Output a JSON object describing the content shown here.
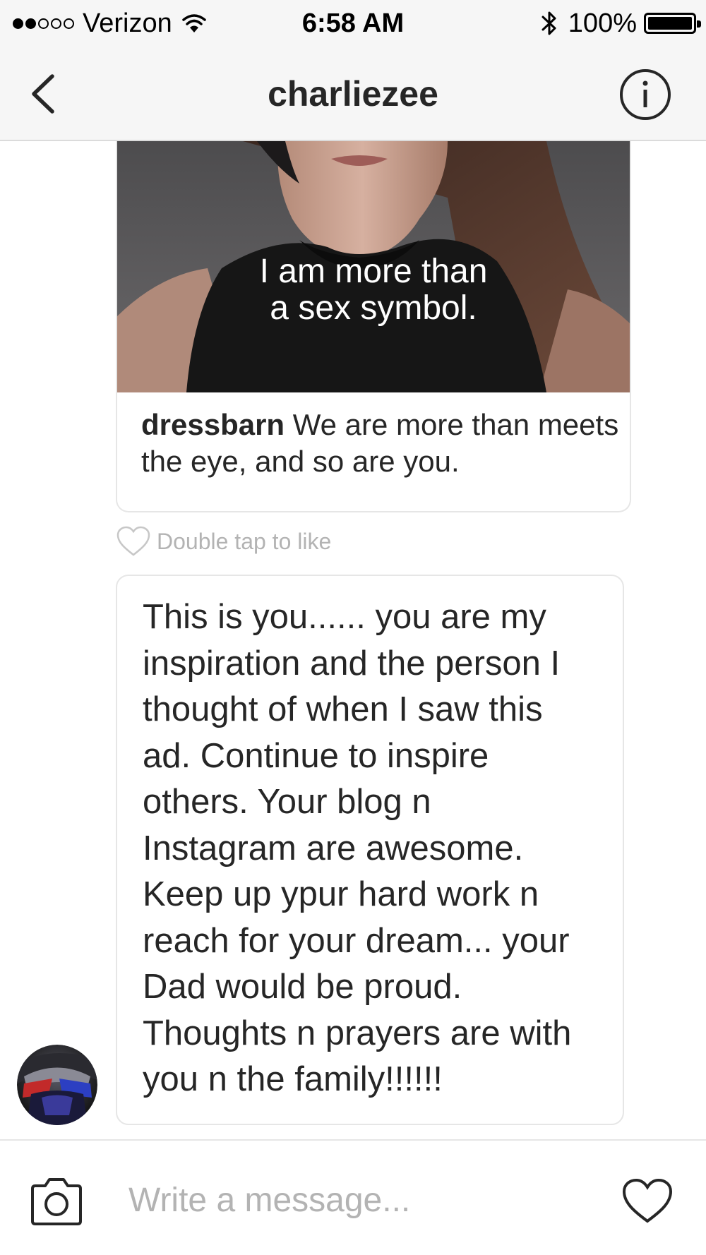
{
  "status_bar": {
    "carrier": "Verizon",
    "time": "6:58 AM",
    "battery": "100%",
    "battery_level": 1.0,
    "signal_bars": 2,
    "signal_total": 5
  },
  "header": {
    "title": "charliezee",
    "back_icon": "chevron-left-icon",
    "info_icon": "info-icon"
  },
  "shared_post": {
    "image_text_line1": "I am more than",
    "image_text_line2": "a sex symbol.",
    "username": "dressbarn",
    "caption": "We are more than meets the eye, and so are you."
  },
  "like_hint": "Double tap to like",
  "message": {
    "text": "This is you...... you are my\ninspiration and the person I\nthought of when I saw this\nad.  Continue to inspire\nothers. Your blog n\nInstagram are awesome.\nKeep up ypur hard work n\nreach for your dream... your\nDad would be proud.\nThoughts n prayers are with\nyou n the family!!!!!!"
  },
  "composer": {
    "placeholder": "Write a message...",
    "camera_icon": "camera-icon",
    "heart_icon": "heart-icon"
  },
  "colors": {
    "bar_background": "#f6f6f6",
    "text": "#262626",
    "muted": "#b3b3b3",
    "border": "#e6e6e6"
  }
}
